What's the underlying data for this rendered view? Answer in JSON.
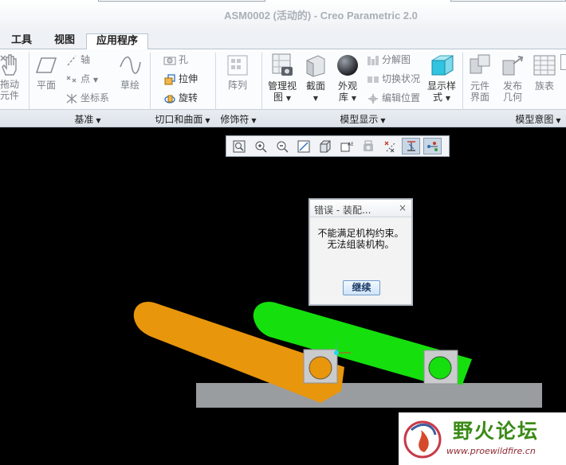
{
  "window": {
    "title": "ASM0002 (活动的) - Creo Parametric 2.0"
  },
  "menu_tabs": [
    {
      "label": "工具",
      "active": false
    },
    {
      "label": "视图",
      "active": false
    },
    {
      "label": "应用程序",
      "active": true
    }
  ],
  "ribbon": {
    "drag_components": {
      "line1": "拖动",
      "line2": "元件"
    },
    "plane": "平面",
    "axis": "轴",
    "point": "点",
    "csys": "坐标系",
    "sketch": "草绘",
    "hole": "孔",
    "extrude": "拉伸",
    "revolve": "旋转",
    "pattern": "阵列",
    "manage_views": {
      "line1": "管理视",
      "line2": "图"
    },
    "section": "截面",
    "appearance": {
      "line1": "外观",
      "line2": "库"
    },
    "exploded_view": "分解图",
    "toggle_status": "切换状况",
    "edit_position": "编辑位置",
    "display_style": {
      "line1": "显示样",
      "line2": "式"
    },
    "component_interface": {
      "line1": "元件",
      "line2": "界面"
    },
    "publish_geometry": {
      "line1": "发布",
      "line2": "几何"
    },
    "family_table": "族表"
  },
  "groups": {
    "datum": "基准",
    "cut_surface": "切口和曲面",
    "modifier": "修饰符",
    "model_display": "模型显示",
    "model_intent": "模型意图"
  },
  "view_toolbar": [
    {
      "name": "zoom-window",
      "active": false
    },
    {
      "name": "zoom-in",
      "active": false
    },
    {
      "name": "zoom-out",
      "active": false
    },
    {
      "name": "refit",
      "active": false
    },
    {
      "name": "display-style",
      "active": false
    },
    {
      "name": "saved-orientations",
      "active": false
    },
    {
      "name": "view-manager",
      "active": false
    },
    {
      "name": "datum-display",
      "active": false
    },
    {
      "name": "spin-center",
      "active": true
    },
    {
      "name": "annotation-display",
      "active": true
    }
  ],
  "dialog": {
    "title": "错误 - 装配...",
    "close": "×",
    "message_line1": "不能满足机构约束。",
    "message_line2": "无法组装机构。",
    "continue_label": "继续"
  },
  "scene": {
    "orange_link_color": "#e8960c",
    "green_link_color": "#15e00d",
    "ground_color": "#9a9da0"
  },
  "watermark": {
    "name": "野火论坛",
    "url": "www.proewildfire.cn"
  },
  "colors": {
    "accent": "#6f9ccc",
    "canvas": "#000000"
  }
}
